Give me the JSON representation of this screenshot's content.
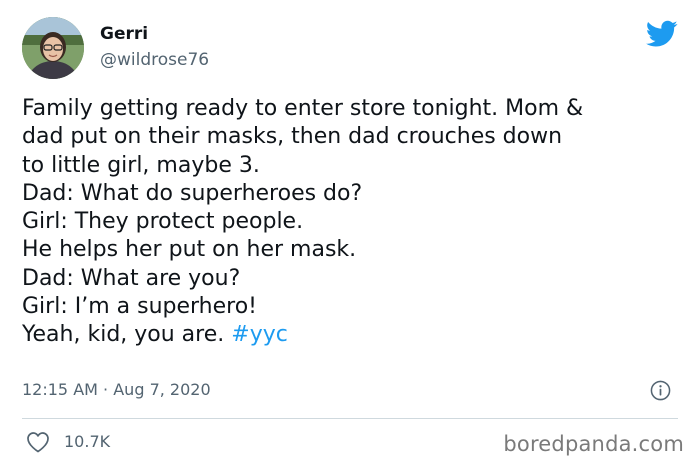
{
  "author": {
    "name": "Gerri",
    "handle": "@wildrose76",
    "avatar_icon": "profile-photo"
  },
  "tweet": {
    "lines": [
      "Family getting ready to enter store tonight. Mom &",
      "dad put on their masks, then dad crouches down",
      "to little girl, maybe 3.",
      "Dad: What do superheroes do?",
      "Girl: They protect people.",
      "He helps her put on her mask.",
      "Dad: What are you?",
      "Girl: I’m a superhero!",
      "Yeah, kid, you are."
    ],
    "hashtag": "#yyc",
    "time": "12:15 AM",
    "separator": "·",
    "date": "Aug 7, 2020"
  },
  "engagement": {
    "likes": "10.7K",
    "like_icon": "heart-icon"
  },
  "watermark": "boredpanda.com",
  "colors": {
    "twitter_blue": "#1d9bf0",
    "text": "#0f1419",
    "secondary": "#536471"
  }
}
